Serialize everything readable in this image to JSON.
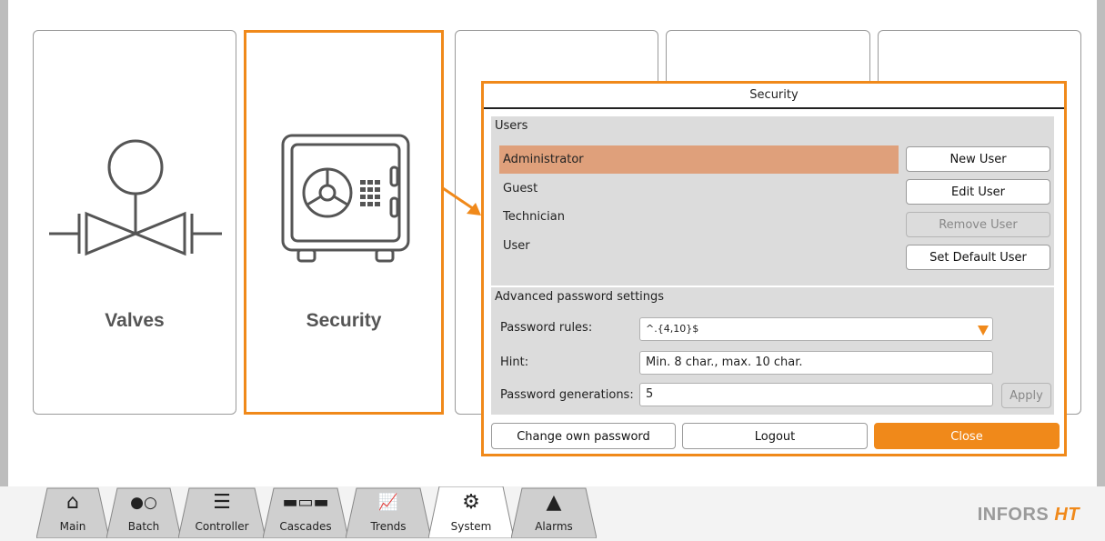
{
  "tiles": {
    "valves_label": "Valves",
    "security_label": "Security"
  },
  "dialog": {
    "title": "Security",
    "users": {
      "section_title": "Users",
      "list": [
        "Administrator",
        "Guest",
        "Technician",
        "User"
      ],
      "selected": "Administrator",
      "buttons": {
        "new_user": "New User",
        "edit_user": "Edit User",
        "remove_user": "Remove User",
        "set_default_user": "Set Default User"
      }
    },
    "advanced": {
      "section_title": "Advanced password settings",
      "password_rules_label": "Password rules:",
      "password_rules_value": "^.{4,10}$",
      "hint_label": "Hint:",
      "hint_value": "Min. 8 char., max. 10 char.",
      "generations_label": "Password generations:",
      "generations_value": "5",
      "apply_label": "Apply"
    },
    "footer": {
      "change_password": "Change own password",
      "logout": "Logout",
      "close": "Close"
    }
  },
  "tabs": [
    {
      "label": "Main",
      "icon": "home-icon"
    },
    {
      "label": "Batch",
      "icon": "batch-icon"
    },
    {
      "label": "Controller",
      "icon": "controller-icon"
    },
    {
      "label": "Cascades",
      "icon": "cascades-icon"
    },
    {
      "label": "Trends",
      "icon": "trends-icon"
    },
    {
      "label": "System",
      "icon": "gears-icon"
    },
    {
      "label": "Alarms",
      "icon": "warning-icon"
    }
  ],
  "active_tab": "System",
  "brand": {
    "text": "INFORS",
    "accent": "HT"
  },
  "colors": {
    "accent": "#f0891a",
    "selected_row": "#dfa07b",
    "panel": "#dcdcdc"
  }
}
